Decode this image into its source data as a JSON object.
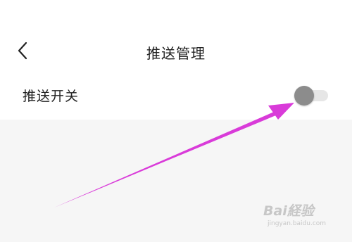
{
  "header": {
    "title": "推送管理",
    "back_icon": "chevron-left-icon"
  },
  "settings": [
    {
      "label": "推送开关",
      "toggle_state": "off"
    }
  ],
  "annotation": {
    "arrow_color": "#d93bd9"
  },
  "watermark": {
    "logo_text": "Bai経验",
    "url": "jingyan.baidu.com"
  },
  "colors": {
    "background": "#ffffff",
    "content_background": "#f6f6f6",
    "text": "#222222",
    "toggle_knob_off": "#8c8c8c",
    "toggle_track_off": "#e6e6e6"
  }
}
